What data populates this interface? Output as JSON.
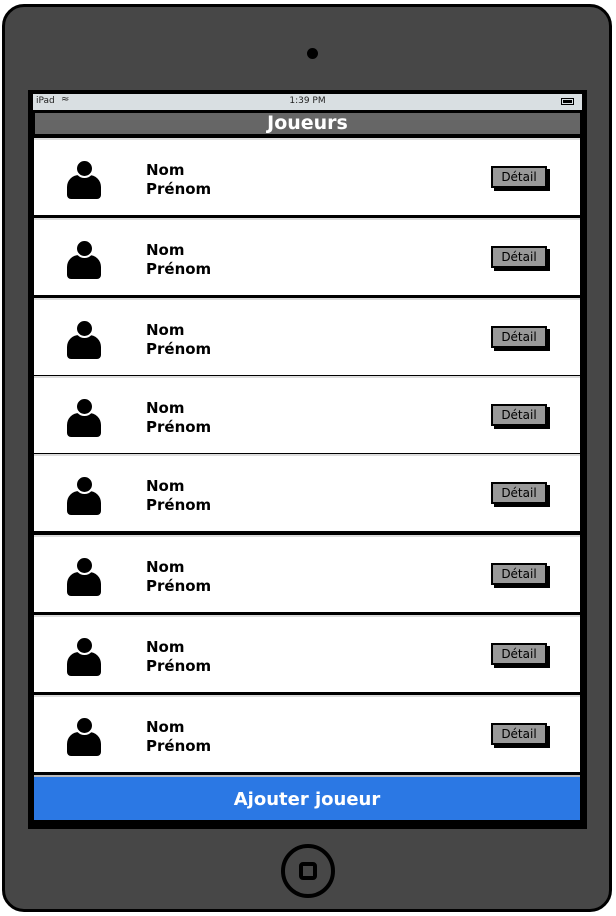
{
  "status_bar": {
    "carrier": "iPad",
    "time": "1:39 PM",
    "wifi_icon": "wifi-icon",
    "battery_icon": "battery-icon"
  },
  "header": {
    "title": "Joueurs"
  },
  "players": [
    {
      "nom": "Nom",
      "prenom": "Prénom",
      "button": "Détail"
    },
    {
      "nom": "Nom",
      "prenom": "Prénom",
      "button": "Détail"
    },
    {
      "nom": "Nom",
      "prenom": "Prénom",
      "button": "Détail"
    },
    {
      "nom": "Nom",
      "prenom": "Prénom",
      "button": "Détail"
    },
    {
      "nom": "Nom",
      "prenom": "Prénom",
      "button": "Détail"
    },
    {
      "nom": "Nom",
      "prenom": "Prénom",
      "button": "Détail"
    },
    {
      "nom": "Nom",
      "prenom": "Prénom",
      "button": "Détail"
    },
    {
      "nom": "Nom",
      "prenom": "Prénom",
      "button": "Détail"
    }
  ],
  "add_button": {
    "label": "Ajouter joueur"
  },
  "colors": {
    "accent": "#2b78e4",
    "header": "#666666",
    "device": "#474747"
  }
}
